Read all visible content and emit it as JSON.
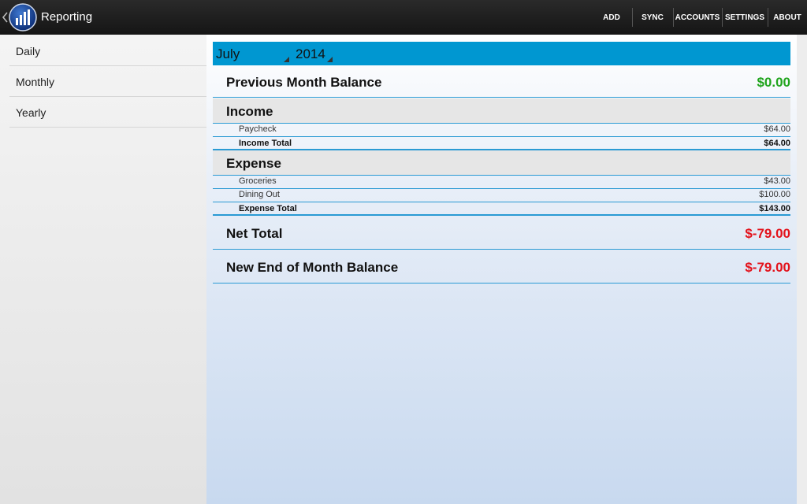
{
  "app": {
    "title": "Reporting"
  },
  "actions": [
    "ADD",
    "SYNC",
    "ACCOUNTS",
    "SETTINGS",
    "ABOUT"
  ],
  "sidebar": {
    "items": [
      "Daily",
      "Monthly",
      "Yearly"
    ]
  },
  "selectors": {
    "month": "July",
    "year": "2014"
  },
  "report": {
    "previous_balance": {
      "label": "Previous Month Balance",
      "value": "$0.00"
    },
    "income": {
      "title": "Income",
      "items": [
        {
          "label": "Paycheck",
          "value": "$64.00"
        }
      ],
      "total": {
        "label": "Income Total",
        "value": "$64.00"
      }
    },
    "expense": {
      "title": "Expense",
      "items": [
        {
          "label": "Groceries",
          "value": "$43.00"
        },
        {
          "label": "Dining Out",
          "value": "$100.00"
        }
      ],
      "total": {
        "label": "Expense Total",
        "value": "$143.00"
      }
    },
    "net_total": {
      "label": "Net Total",
      "value": "$-79.00"
    },
    "end_balance": {
      "label": "New End of Month Balance",
      "value": "$-79.00"
    }
  },
  "colors": {
    "accent": "#0097d1",
    "positive": "#1fa41c",
    "negative": "#e3121b",
    "divider": "#2a9ad4"
  }
}
